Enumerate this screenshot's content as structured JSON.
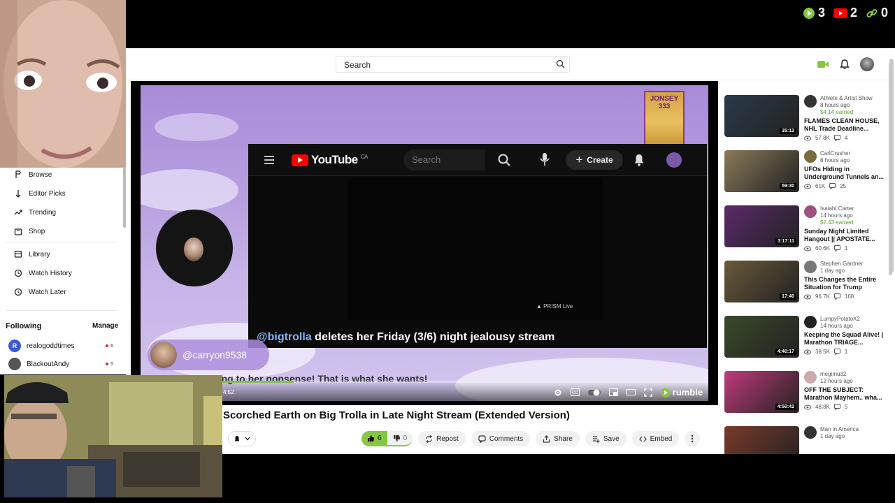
{
  "counters": {
    "rumble": "3",
    "youtube": "2",
    "links": "0"
  },
  "search": {
    "placeholder": "Search"
  },
  "nav": {
    "items": [
      {
        "label": "Browse"
      },
      {
        "label": "Editor Picks"
      },
      {
        "label": "Trending"
      },
      {
        "label": "Shop"
      },
      {
        "label": "Library"
      },
      {
        "label": "Watch History"
      },
      {
        "label": "Watch Later"
      }
    ],
    "following_title": "Following",
    "manage_label": "Manage",
    "following": [
      {
        "name": "realogoddtimes",
        "count": "6",
        "initial": "R",
        "color": "#3b5bdb"
      },
      {
        "name": "BlackoutAndy",
        "count": "5",
        "initial": "",
        "color": "#555555"
      }
    ]
  },
  "video": {
    "title": "Scorched Earth on Big Trolla in Late Night Stream (Extended Version)",
    "time": "4:52",
    "progress": 0.27,
    "brand": "rumble",
    "overlay": {
      "yt_logo": "YouTube",
      "yt_region": "CA",
      "yt_search": "Search",
      "yt_create": "Create",
      "prism": "PRISM Live",
      "caption_handle": "@bigtrolla",
      "caption_text": " deletes her Friday (3/6) night jealousy stream",
      "commenter": "@carryon9538",
      "comment_text": "...s are reacting to her nonsense! That is what she wants!",
      "badge": "JONSEY 333"
    }
  },
  "actions": {
    "likes": "6",
    "dislikes": "0",
    "repost": "Repost",
    "comments": "Comments",
    "share": "Share",
    "save": "Save",
    "embed": "Embed"
  },
  "sidebar": [
    {
      "channel": "Athlete & Artist Show",
      "age": "8 hours ago",
      "earned": "$4.14 earned",
      "title": "FLAMES CLEAN HOUSE, NHL Trade Deadline...",
      "views": "57.8K",
      "comments": "4",
      "duration": "35:12",
      "thumb": "#2a3a4a",
      "av": "#333"
    },
    {
      "channel": "CarlCrusher",
      "age": "8 hours ago",
      "earned": "",
      "title": "UFOs Hiding in Underground Tunnels an...",
      "views": "61K",
      "comments": "25",
      "duration": "59:30",
      "thumb": "#8a7a5a",
      "av": "#7a6a40"
    },
    {
      "channel": "IsaiahLCarter",
      "age": "14 hours ago",
      "earned": "$2.43 earned",
      "title": "Sunday Night Limited Hangout || APOSTATE...",
      "views": "60.6K",
      "comments": "1",
      "duration": "3:17:11",
      "thumb": "#5a2a6a",
      "av": "#a05080"
    },
    {
      "channel": "Stephen Gardner",
      "age": "1 day ago",
      "earned": "",
      "title": "This Changes the Entire Situation for Trump",
      "views": "96.7K",
      "comments": "168",
      "duration": "17:40",
      "thumb": "#6a5a3a",
      "av": "#777"
    },
    {
      "channel": "LumpyPotatoX2",
      "age": "14 hours ago",
      "earned": "",
      "title": "Keeping the Squad Alive! | Marathon TRIAGE...",
      "views": "38.5K",
      "comments": "1",
      "duration": "4:40:17",
      "thumb": "#3a4a2a",
      "av": "#222"
    },
    {
      "channel": "megimu32",
      "age": "12 hours ago",
      "earned": "",
      "title": "OFF THE SUBJECT: Marathon Mayhem.. wha...",
      "views": "48.8K",
      "comments": "5",
      "duration": "4:50:42",
      "thumb": "#c03a7a",
      "av": "#caa"
    },
    {
      "channel": "Man in America",
      "age": "1 day ago",
      "earned": "",
      "title": "",
      "views": "",
      "comments": "",
      "duration": "",
      "thumb": "#7a3a2a",
      "av": "#333"
    }
  ]
}
